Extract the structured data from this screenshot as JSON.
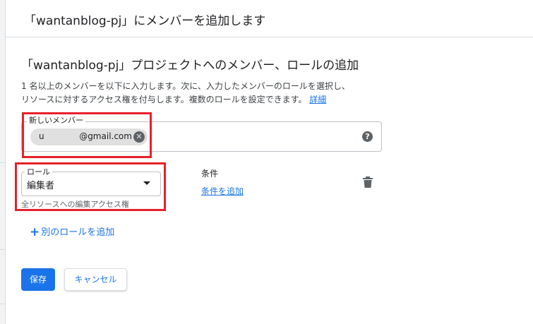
{
  "dialog": {
    "title": "「wantanblog-pj」にメンバーを追加します"
  },
  "section": {
    "title": "「wantanblog-pj」プロジェクトへのメンバー、ロールの追加",
    "description_line1": "1 名以上のメンバーを以下に入力します。次に、入力したメンバーのロールを選択し、",
    "description_line2": "リソースに対するアクセス権を付与します。複数のロールを設定できます。",
    "details_link": "詳細"
  },
  "members": {
    "label": "新しいメンバー",
    "chip_text": "u             @gmail.com",
    "help_icon": "help-circle-icon"
  },
  "role": {
    "label": "ロール",
    "value": "編集者",
    "help_text": "全リソースへの編集アクセス権"
  },
  "condition": {
    "label": "条件",
    "add_link": "条件を追加",
    "delete_icon": "trash-icon"
  },
  "add_role": {
    "label": "別のロールを追加"
  },
  "buttons": {
    "save": "保存",
    "cancel": "キャンセル"
  },
  "colors": {
    "accent": "#1a73e8",
    "highlight": "#e5212a"
  }
}
